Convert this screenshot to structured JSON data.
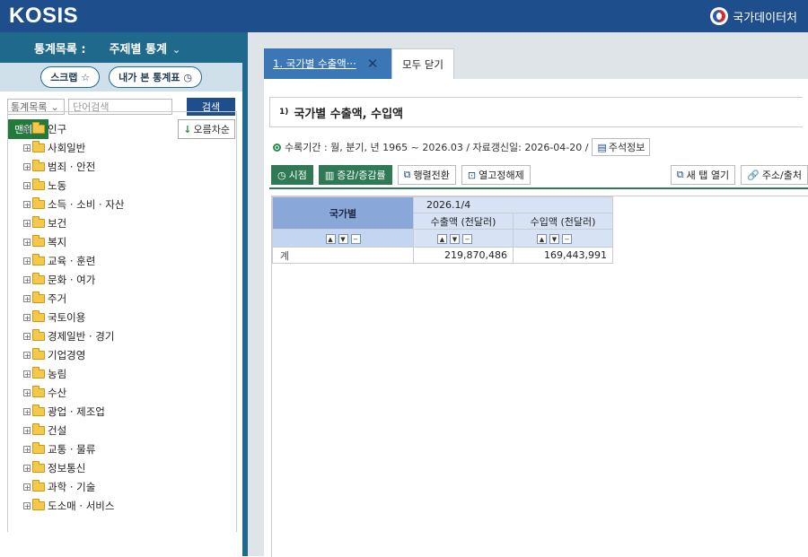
{
  "header": {
    "logo": "KOSIS",
    "agency": "국가데이터처"
  },
  "left_panel": {
    "menu_title": "통계목록 :",
    "menu_value": "주제별 통계",
    "caret": "⌄",
    "scrap_label": "스크랩 ☆",
    "my_tables_label": "내가 본 통계표 ◷",
    "search_select": "통계목록",
    "search_placeholder": "단어검색",
    "search_button": "검색",
    "top_button": "맨위로",
    "sort_button": "오름차순",
    "tree_items": [
      "인구",
      "사회일반",
      "범죄 · 안전",
      "노동",
      "소득 · 소비 · 자산",
      "보건",
      "복지",
      "교육 · 훈련",
      "문화 · 여가",
      "주거",
      "국토이용",
      "경제일반 · 경기",
      "기업경영",
      "농림",
      "수산",
      "광업 · 제조업",
      "건설",
      "교통 · 물류",
      "정보통신",
      "과학 · 기술",
      "도소매 · 서비스"
    ]
  },
  "tabs": {
    "active_label": "1. 국가별 수출액···",
    "close_icon": "✕",
    "close_all": "모두 닫기"
  },
  "table_title": {
    "sup": "1)",
    "text": "국가별 수출액, 수입액"
  },
  "info": {
    "period": "수록기간 : 월, 분기, 년 1965 ~ 2026.03 / 자료갱신일: 2026-04-20 /",
    "memo": "주석정보"
  },
  "toolbar": {
    "time": "시점",
    "change": "증감/증감률",
    "pivot": "행렬전환",
    "unfix": "열고정해제",
    "new_tab": "새 탭 열기",
    "address": "주소/출처"
  },
  "grid": {
    "row_header": "국가별",
    "period": "2026.1/4",
    "col1": "수출액 (천달러)",
    "col2": "수입액 (천달러)",
    "rows": [
      {
        "label": "계",
        "export": "219,870,486",
        "import": "169,443,991"
      }
    ]
  }
}
